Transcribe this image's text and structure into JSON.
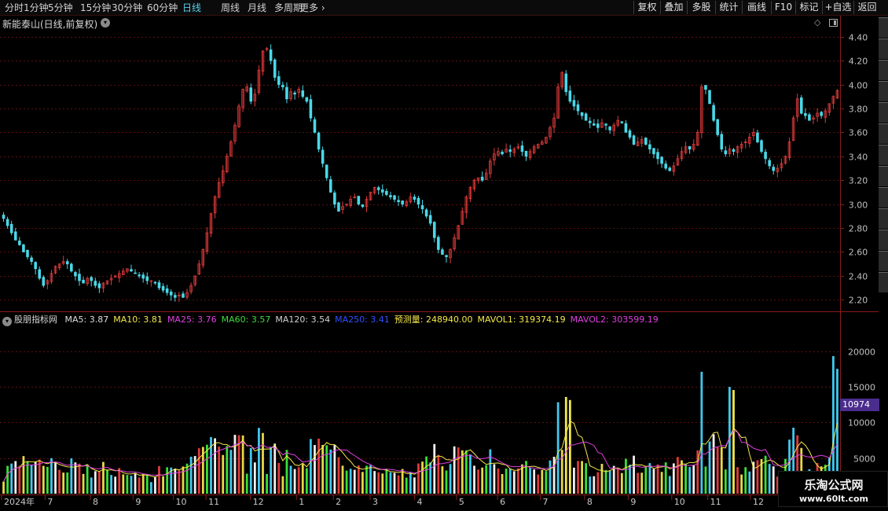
{
  "toolbar": {
    "periods": [
      "分时",
      "1分钟",
      "5分钟",
      "15分钟",
      "30分钟",
      "60分钟",
      "日线",
      "周线",
      "月线",
      "多周期",
      "更多"
    ],
    "active_period": "日线",
    "tools": [
      "复权",
      "叠加",
      "多股",
      "统计",
      "画线",
      "F10",
      "标记",
      "+自选",
      "返回"
    ]
  },
  "stock": {
    "title": "新能泰山(日线,前复权)"
  },
  "indicator": {
    "name": "股朋指标网",
    "items": [
      {
        "text": "MA5: 3.87",
        "color": "#dcdcdc"
      },
      {
        "text": "MA10: 3.81",
        "color": "#f4e84a"
      },
      {
        "text": "MA25: 3.76",
        "color": "#e040e0"
      },
      {
        "text": "MA60: 3.57",
        "color": "#3cdc3c"
      },
      {
        "text": "MA120: 3.54",
        "color": "#d0d0d0"
      },
      {
        "text": "MA250: 3.41",
        "color": "#3050ff"
      },
      {
        "text": "预测量: 248940.00",
        "color": "#f4e84a"
      },
      {
        "text": "MAVOL1: 319374.19",
        "color": "#f4e84a"
      },
      {
        "text": "MAVOL2: 303599.19",
        "color": "#e040e0"
      }
    ],
    "current_value": "10974"
  },
  "price_axis": [
    "4.40",
    "4.20",
    "4.00",
    "3.80",
    "3.60",
    "3.40",
    "3.20",
    "3.00",
    "2.80",
    "2.60",
    "2.40",
    "2.20"
  ],
  "volume_axis": [
    "20000",
    "15000",
    "10000",
    "5000"
  ],
  "date_axis": [
    {
      "label": "2024年",
      "pos": 0.0
    },
    {
      "label": "7",
      "pos": 0.052
    },
    {
      "label": "8",
      "pos": 0.106
    },
    {
      "label": "9",
      "pos": 0.157
    },
    {
      "label": "10",
      "pos": 0.205
    },
    {
      "label": "11",
      "pos": 0.244
    },
    {
      "label": "12",
      "pos": 0.297
    },
    {
      "label": "1",
      "pos": 0.352
    },
    {
      "label": "2",
      "pos": 0.396
    },
    {
      "label": "3",
      "pos": 0.44
    },
    {
      "label": "4",
      "pos": 0.493
    },
    {
      "label": "5",
      "pos": 0.543
    },
    {
      "label": "6",
      "pos": 0.592
    },
    {
      "label": "7",
      "pos": 0.643
    },
    {
      "label": "8",
      "pos": 0.696
    },
    {
      "label": "9",
      "pos": 0.748
    },
    {
      "label": "10",
      "pos": 0.8
    },
    {
      "label": "11",
      "pos": 0.843
    },
    {
      "label": "12",
      "pos": 0.894
    }
  ],
  "watermark": {
    "line1": "乐淘公式网",
    "line2": "www.60lt.com"
  },
  "colors": {
    "up": "#e03a3a",
    "down": "#4ad8e8",
    "axis": "#8a1c1c",
    "grid": "#5a1010",
    "ma10": "#f4e84a",
    "ma25": "#e040e0"
  },
  "chart_data": {
    "type": "candlestick",
    "price_range": [
      2.13,
      4.47
    ],
    "volume_range": [
      0,
      23500
    ],
    "closes": [
      2.88,
      2.82,
      2.76,
      2.7,
      2.66,
      2.6,
      2.56,
      2.52,
      2.46,
      2.38,
      2.32,
      2.36,
      2.42,
      2.48,
      2.5,
      2.52,
      2.5,
      2.44,
      2.4,
      2.36,
      2.34,
      2.38,
      2.36,
      2.32,
      2.3,
      2.34,
      2.36,
      2.38,
      2.4,
      2.42,
      2.44,
      2.46,
      2.44,
      2.42,
      2.4,
      2.38,
      2.36,
      2.36,
      2.34,
      2.3,
      2.28,
      2.26,
      2.24,
      2.22,
      2.24,
      2.22,
      2.26,
      2.32,
      2.4,
      2.5,
      2.62,
      2.76,
      2.92,
      3.06,
      3.18,
      3.28,
      3.4,
      3.52,
      3.66,
      3.82,
      3.96,
      3.98,
      3.86,
      3.92,
      4.12,
      4.28,
      4.3,
      4.2,
      4.06,
      4.0,
      3.98,
      3.88,
      3.94,
      3.92,
      3.96,
      3.9,
      3.86,
      3.72,
      3.6,
      3.46,
      3.34,
      3.22,
      3.1,
      3.0,
      2.94,
      2.98,
      3.0,
      3.04,
      3.06,
      3.0,
      2.98,
      3.04,
      3.1,
      3.14,
      3.12,
      3.1,
      3.08,
      3.06,
      3.04,
      3.02,
      3.0,
      3.02,
      3.06,
      3.04,
      3.0,
      2.96,
      2.9,
      2.84,
      2.72,
      2.62,
      2.58,
      2.56,
      2.62,
      2.72,
      2.82,
      2.94,
      3.06,
      3.14,
      3.2,
      3.22,
      3.2,
      3.26,
      3.36,
      3.42,
      3.44,
      3.42,
      3.46,
      3.44,
      3.46,
      3.48,
      3.44,
      3.4,
      3.44,
      3.48,
      3.5,
      3.52,
      3.56,
      3.64,
      3.72,
      3.98,
      4.1,
      3.94,
      3.86,
      3.82,
      3.78,
      3.74,
      3.7,
      3.68,
      3.66,
      3.64,
      3.68,
      3.66,
      3.62,
      3.66,
      3.7,
      3.68,
      3.6,
      3.56,
      3.5,
      3.52,
      3.54,
      3.5,
      3.46,
      3.42,
      3.38,
      3.34,
      3.3,
      3.28,
      3.32,
      3.38,
      3.44,
      3.48,
      3.46,
      3.5,
      3.6,
      3.98,
      3.96,
      3.84,
      3.7,
      3.58,
      3.46,
      3.42,
      3.46,
      3.44,
      3.48,
      3.5,
      3.52,
      3.56,
      3.6,
      3.52,
      3.44,
      3.38,
      3.32,
      3.28,
      3.3,
      3.34,
      3.4,
      3.52,
      3.72,
      3.88,
      3.76,
      3.74,
      3.7,
      3.72,
      3.76,
      3.74,
      3.78,
      3.84,
      3.9,
      3.95
    ]
  }
}
